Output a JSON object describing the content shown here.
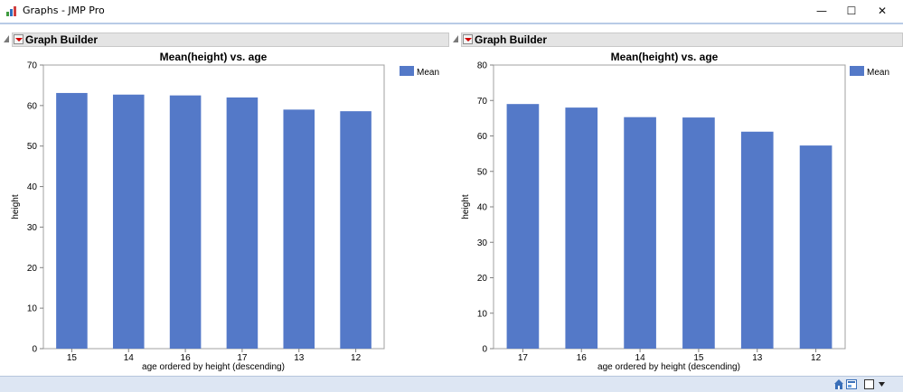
{
  "window": {
    "title": "Graphs - JMP Pro",
    "controls": {
      "minimize": "—",
      "maximize": "☐",
      "close": "✕"
    }
  },
  "panels": [
    {
      "header": "Graph Builder",
      "chart": {
        "title": "Mean(height) vs. age",
        "xlabel": "age ordered by height (descending)",
        "ylabel": "height",
        "legend": "Mean"
      }
    },
    {
      "header": "Graph Builder",
      "chart": {
        "title": "Mean(height) vs. age",
        "xlabel": "age ordered by height (descending)",
        "ylabel": "height",
        "legend": "Mean"
      }
    }
  ],
  "colors": {
    "bar": "#5479c8",
    "accent_red": "#d00000",
    "statusbar": "#dde6f3"
  },
  "icons": [
    "app-icon",
    "disclosure-icon",
    "red-triangle-menu-icon",
    "home-icon",
    "window-list-icon",
    "checkbox-icon",
    "dropdown-arrow-icon"
  ],
  "chart_data": [
    {
      "type": "bar",
      "title": "Mean(height) vs. age",
      "xlabel": "age ordered by height (descending)",
      "ylabel": "height",
      "categories": [
        "15",
        "14",
        "16",
        "17",
        "13",
        "12"
      ],
      "series": [
        {
          "name": "Mean",
          "values": [
            63.1,
            62.7,
            62.5,
            62.0,
            59.0,
            58.6
          ]
        }
      ],
      "ylim": [
        0,
        70
      ],
      "yticks": [
        0,
        10,
        20,
        30,
        40,
        50,
        60,
        70
      ],
      "grid": false,
      "legend_position": "right"
    },
    {
      "type": "bar",
      "title": "Mean(height) vs. age",
      "xlabel": "age ordered by height (descending)",
      "ylabel": "height",
      "categories": [
        "17",
        "16",
        "14",
        "15",
        "13",
        "12"
      ],
      "series": [
        {
          "name": "Mean",
          "values": [
            69.0,
            68.0,
            65.3,
            65.2,
            61.2,
            57.3
          ]
        }
      ],
      "ylim": [
        0,
        80
      ],
      "yticks": [
        0,
        10,
        20,
        30,
        40,
        50,
        60,
        70,
        80
      ],
      "grid": false,
      "legend_position": "right"
    }
  ]
}
